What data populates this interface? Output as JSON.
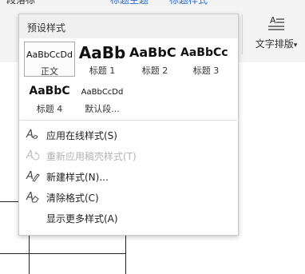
{
  "ribbon": {
    "tab_left": "段落标",
    "tab_mid1": "标题主题",
    "tab_mid2": "标题样式",
    "text_layout_label": "文字排版",
    "text_layout_arrow": "▾"
  },
  "panel": {
    "header": "预设样式",
    "styles": [
      {
        "sample": "AaBbCcDd",
        "name": "正文"
      },
      {
        "sample": "AaBb",
        "name": "标题 1"
      },
      {
        "sample": "AaBbC",
        "name": "标题 2"
      },
      {
        "sample": "AaBbCc",
        "name": "标题 3"
      },
      {
        "sample": "AaBbC",
        "name": "标题 4"
      },
      {
        "sample": "AaBbCcDd",
        "name": "默认段..."
      }
    ],
    "menu": [
      {
        "label": "应用在线样式(S)",
        "icon": "style-a-icon",
        "enabled": true
      },
      {
        "label": "重新应用稿壳样式(T)",
        "icon": "reapply-style-icon",
        "enabled": false
      },
      {
        "label": "新建样式(N)...",
        "icon": "new-style-icon",
        "enabled": true
      },
      {
        "label": "清除格式(C)",
        "icon": "clear-format-icon",
        "enabled": true
      },
      {
        "label": "显示更多样式(A)",
        "icon": "",
        "enabled": true
      }
    ]
  }
}
